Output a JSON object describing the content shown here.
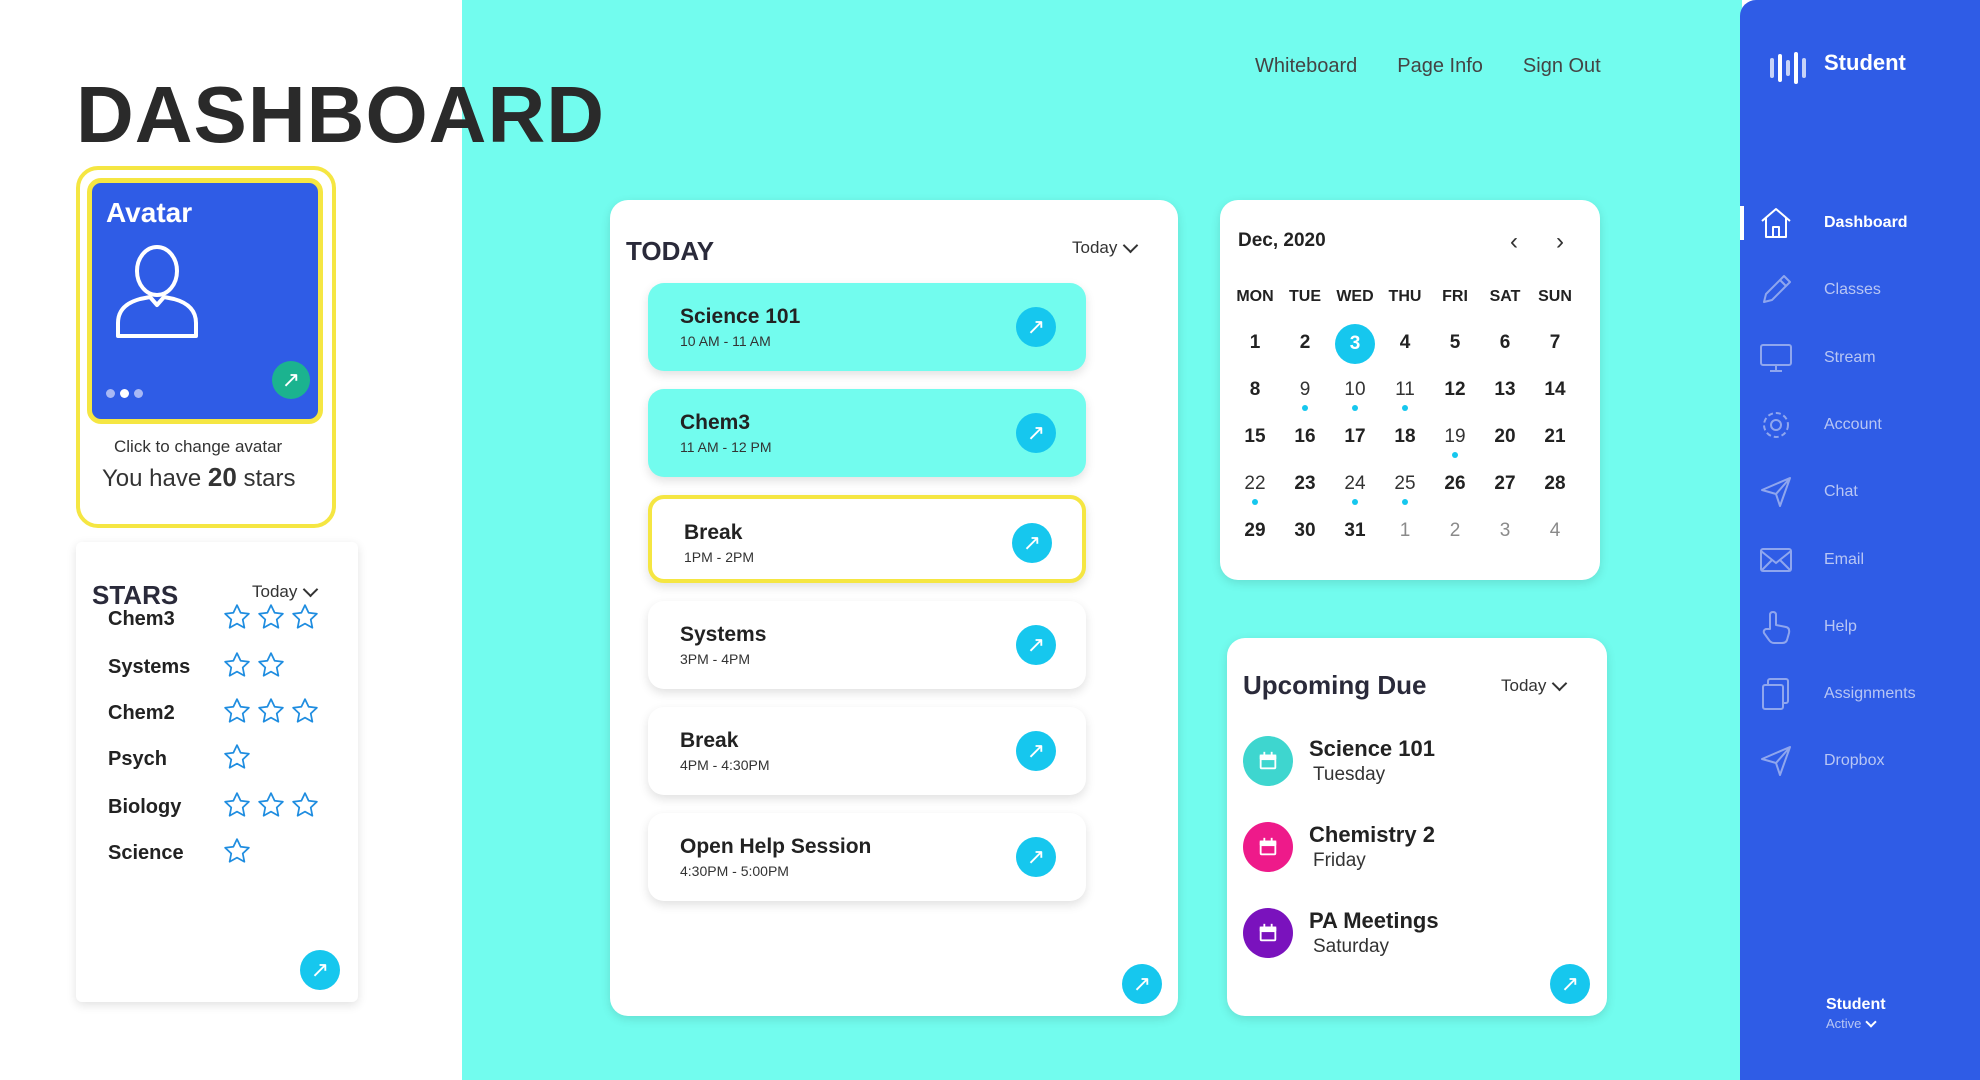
{
  "header": {
    "title": "DASHBOARD",
    "nav": [
      "Whiteboard",
      "Page Info",
      "Sign Out"
    ]
  },
  "avatar": {
    "title": "Avatar",
    "hint": "Click to change avatar",
    "stars_prefix": "You have",
    "stars_count": "20",
    "stars_suffix": "stars"
  },
  "stars": {
    "title": "STARS",
    "filter": "Today",
    "rows": [
      {
        "label": "Chem3",
        "count": 3
      },
      {
        "label": "Systems",
        "count": 2
      },
      {
        "label": "Chem2",
        "count": 3
      },
      {
        "label": "Psych",
        "count": 1
      },
      {
        "label": "Biology",
        "count": 3
      },
      {
        "label": "Science",
        "count": 1
      }
    ]
  },
  "today": {
    "title": "TODAY",
    "filter": "Today",
    "items": [
      {
        "title": "Science 101",
        "time": "10 AM - 11 AM",
        "style": "cyan"
      },
      {
        "title": "Chem3",
        "time": "11 AM - 12 PM",
        "style": "cyan"
      },
      {
        "title": "Break",
        "time": "1PM - 2PM",
        "style": "highlight"
      },
      {
        "title": "Systems",
        "time": "3PM - 4PM",
        "style": "plain"
      },
      {
        "title": "Break",
        "time": "4PM - 4:30PM",
        "style": "plain"
      },
      {
        "title": "Open Help Session",
        "time": "4:30PM - 5:00PM",
        "style": "plain"
      }
    ]
  },
  "calendar": {
    "month": "Dec, 2020",
    "weekdays": [
      "MON",
      "TUE",
      "WED",
      "THU",
      "FRI",
      "SAT",
      "SUN"
    ],
    "days": [
      {
        "d": "1"
      },
      {
        "d": "2"
      },
      {
        "d": "3",
        "selected": true
      },
      {
        "d": "4"
      },
      {
        "d": "5"
      },
      {
        "d": "6"
      },
      {
        "d": "7"
      },
      {
        "d": "8"
      },
      {
        "d": "9",
        "dot": true,
        "light": true
      },
      {
        "d": "10",
        "dot": true,
        "light": true
      },
      {
        "d": "11",
        "dot": true,
        "light": true
      },
      {
        "d": "12"
      },
      {
        "d": "13"
      },
      {
        "d": "14"
      },
      {
        "d": "15"
      },
      {
        "d": "16"
      },
      {
        "d": "17"
      },
      {
        "d": "18"
      },
      {
        "d": "19",
        "dot": true,
        "light": true
      },
      {
        "d": "20"
      },
      {
        "d": "21"
      },
      {
        "d": "22",
        "dot": true,
        "light": true
      },
      {
        "d": "23"
      },
      {
        "d": "24",
        "dot": true,
        "light": true
      },
      {
        "d": "25",
        "dot": true,
        "light": true
      },
      {
        "d": "26"
      },
      {
        "d": "27"
      },
      {
        "d": "28"
      },
      {
        "d": "29"
      },
      {
        "d": "30"
      },
      {
        "d": "31"
      },
      {
        "d": "1",
        "muted": true
      },
      {
        "d": "2",
        "muted": true
      },
      {
        "d": "3",
        "muted": true
      },
      {
        "d": "4",
        "muted": true
      }
    ]
  },
  "upcoming": {
    "title": "Upcoming Due",
    "filter": "Today",
    "items": [
      {
        "name": "Science 101",
        "when": "Tuesday",
        "color": "#3ed6cf"
      },
      {
        "name": "Chemistry 2",
        "when": "Friday",
        "color": "#ee1a8a"
      },
      {
        "name": "PA Meetings",
        "when": "Saturday",
        "color": "#7a12bd"
      }
    ]
  },
  "sidebar": {
    "brand": "Student",
    "items": [
      {
        "label": "Dashboard",
        "icon": "home-icon",
        "active": true
      },
      {
        "label": "Classes",
        "icon": "pencil-icon"
      },
      {
        "label": "Stream",
        "icon": "monitor-icon"
      },
      {
        "label": "Account",
        "icon": "gear-icon"
      },
      {
        "label": "Chat",
        "icon": "send-icon"
      },
      {
        "label": "Email",
        "icon": "mail-icon"
      },
      {
        "label": "Help",
        "icon": "hand-pointer-icon"
      },
      {
        "label": "Assignments",
        "icon": "copy-icon"
      },
      {
        "label": "Dropbox",
        "icon": "send-icon"
      }
    ],
    "user_name": "Student",
    "user_status": "Active"
  },
  "colors": {
    "accent_cyan": "#72fcee",
    "sidebar_blue": "#2f5ce6",
    "button_cyan": "#16c7ee",
    "highlight_yellow": "#f5e642"
  }
}
